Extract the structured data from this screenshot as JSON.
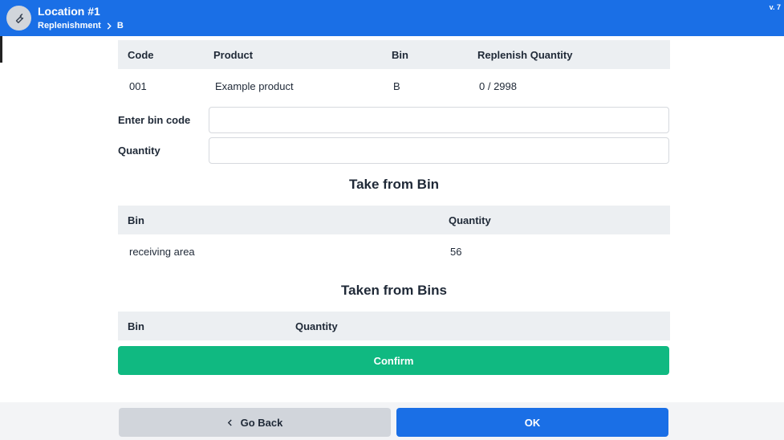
{
  "header": {
    "title": "Location #1",
    "breadcrumb": [
      "Replenishment",
      "B"
    ],
    "version": "v. 7",
    "tool_icon": "wrench-icon"
  },
  "product_table": {
    "columns": [
      "Code",
      "Product",
      "Bin",
      "Replenish Quantity"
    ],
    "rows": [
      {
        "code": "001",
        "product": "Example product",
        "bin": "B",
        "qty": "0 / 2998"
      }
    ]
  },
  "form": {
    "bin_code_label": "Enter bin code",
    "bin_code_value": "",
    "quantity_label": "Quantity",
    "quantity_value": ""
  },
  "take_from_bin": {
    "title": "Take from Bin",
    "columns": [
      "Bin",
      "Quantity"
    ],
    "rows": [
      {
        "bin": "receiving area",
        "qty": "56"
      }
    ]
  },
  "taken_from_bins": {
    "title": "Taken from Bins",
    "columns": [
      "Bin",
      "Quantity"
    ]
  },
  "actions": {
    "confirm_label": "Confirm",
    "back_label": "Go Back",
    "back_icon": "chevron-left-icon",
    "ok_label": "OK"
  },
  "colors": {
    "primary": "#1a6fe6",
    "confirm": "#10b981"
  }
}
